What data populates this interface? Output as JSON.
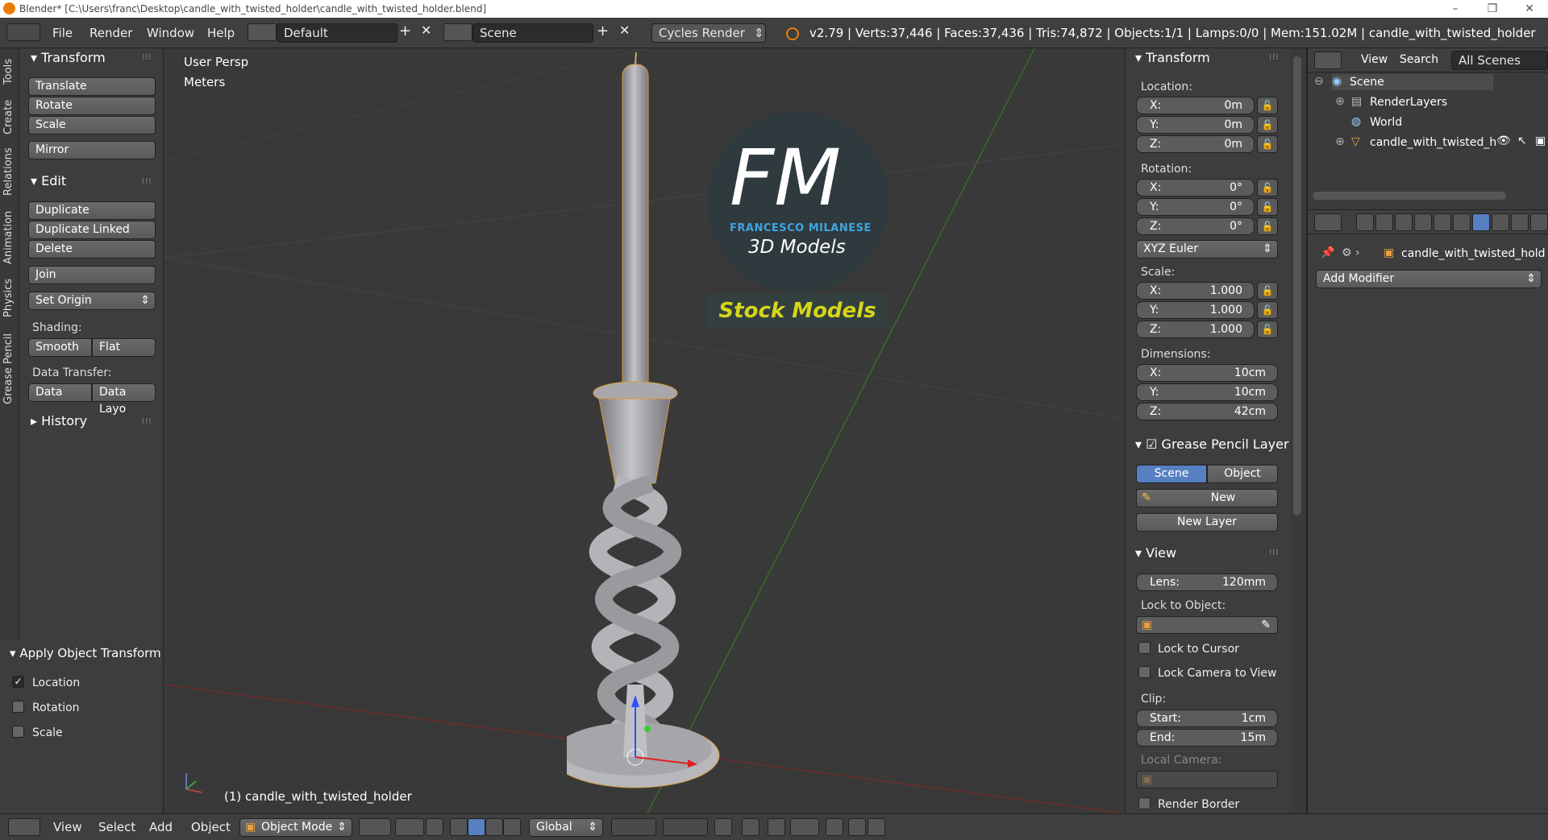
{
  "window": {
    "title": "Blender* [C:\\Users\\franc\\Desktop\\candle_with_twisted_holder\\candle_with_twisted_holder.blend]",
    "minimize": "–",
    "maximize": "❐",
    "close": "✕"
  },
  "menubar": {
    "items": [
      "File",
      "Render",
      "Window",
      "Help"
    ],
    "layout": "Default",
    "scene": "Scene",
    "engine": "Cycles Render",
    "info": "v2.79 | Verts:37,446 | Faces:37,436 | Tris:74,872 | Objects:1/1 | Lamps:0/0 | Mem:151.02M | candle_with_twisted_holder"
  },
  "tool_tabs": [
    "Tools",
    "Create",
    "Relations",
    "Animation",
    "Physics",
    "Grease Pencil"
  ],
  "tools": {
    "transform_title": "Transform",
    "translate": "Translate",
    "rotate": "Rotate",
    "scale": "Scale",
    "mirror": "Mirror",
    "edit_title": "Edit",
    "duplicate": "Duplicate",
    "duplicate_linked": "Duplicate Linked",
    "delete": "Delete",
    "join": "Join",
    "set_origin": "Set Origin",
    "shading_label": "Shading:",
    "smooth": "Smooth",
    "flat": "Flat",
    "data_transfer_label": "Data Transfer:",
    "data": "Data",
    "data_layout": "Data Layo",
    "history": "History"
  },
  "operator": {
    "title": "Apply Object Transform",
    "location": "Location",
    "rotation": "Rotation",
    "scale": "Scale",
    "location_checked": true,
    "rotation_checked": false,
    "scale_checked": false
  },
  "viewport": {
    "view_name": "User Persp",
    "units": "Meters",
    "object_label": "(1) candle_with_twisted_holder",
    "logo_fm": "FM",
    "logo_name": "FRANCESCO MILANESE",
    "logo_sub": "3D Models",
    "logo_stock": "Stock Models"
  },
  "nprops": {
    "transform_title": "Transform",
    "location_label": "Location:",
    "rotation_label": "Rotation:",
    "scale_label": "Scale:",
    "dimensions_label": "Dimensions:",
    "loc": [
      {
        "k": "X:",
        "v": "0m"
      },
      {
        "k": "Y:",
        "v": "0m"
      },
      {
        "k": "Z:",
        "v": "0m"
      }
    ],
    "rot": [
      {
        "k": "X:",
        "v": "0°"
      },
      {
        "k": "Y:",
        "v": "0°"
      },
      {
        "k": "Z:",
        "v": "0°"
      }
    ],
    "rot_mode": "XYZ Euler",
    "scl": [
      {
        "k": "X:",
        "v": "1.000"
      },
      {
        "k": "Y:",
        "v": "1.000"
      },
      {
        "k": "Z:",
        "v": "1.000"
      }
    ],
    "dim": [
      {
        "k": "X:",
        "v": "10cm"
      },
      {
        "k": "Y:",
        "v": "10cm"
      },
      {
        "k": "Z:",
        "v": "42cm"
      }
    ],
    "gp_title": "Grease Pencil Layer",
    "gp_scene": "Scene",
    "gp_object": "Object",
    "gp_new": "New",
    "gp_new_layer": "New Layer",
    "view_title": "View",
    "lens_k": "Lens:",
    "lens_v": "120mm",
    "lock_obj": "Lock to Object:",
    "lock_cursor": "Lock to Cursor",
    "lock_camera": "Lock Camera to View",
    "clip": "Clip:",
    "clip_start_k": "Start:",
    "clip_start_v": "1cm",
    "clip_end_k": "End:",
    "clip_end_v": "15m",
    "local_camera": "Local Camera:",
    "render_border": "Render Border"
  },
  "outliner": {
    "tabs": [
      "View",
      "Search",
      "All Scenes"
    ],
    "scene": "Scene",
    "render_layers": "RenderLayers",
    "world": "World",
    "object": "candle_with_twisted_h"
  },
  "properties": {
    "object": "candle_with_twisted_hold",
    "add_modifier": "Add Modifier"
  },
  "header": {
    "view": "View",
    "select": "Select",
    "add": "Add",
    "object": "Object",
    "mode": "Object Mode",
    "orientation": "Global"
  },
  "colors": {
    "accent": "#5680c2",
    "logo_blue": "#3fa6e0",
    "stock": "#d6d61a"
  }
}
